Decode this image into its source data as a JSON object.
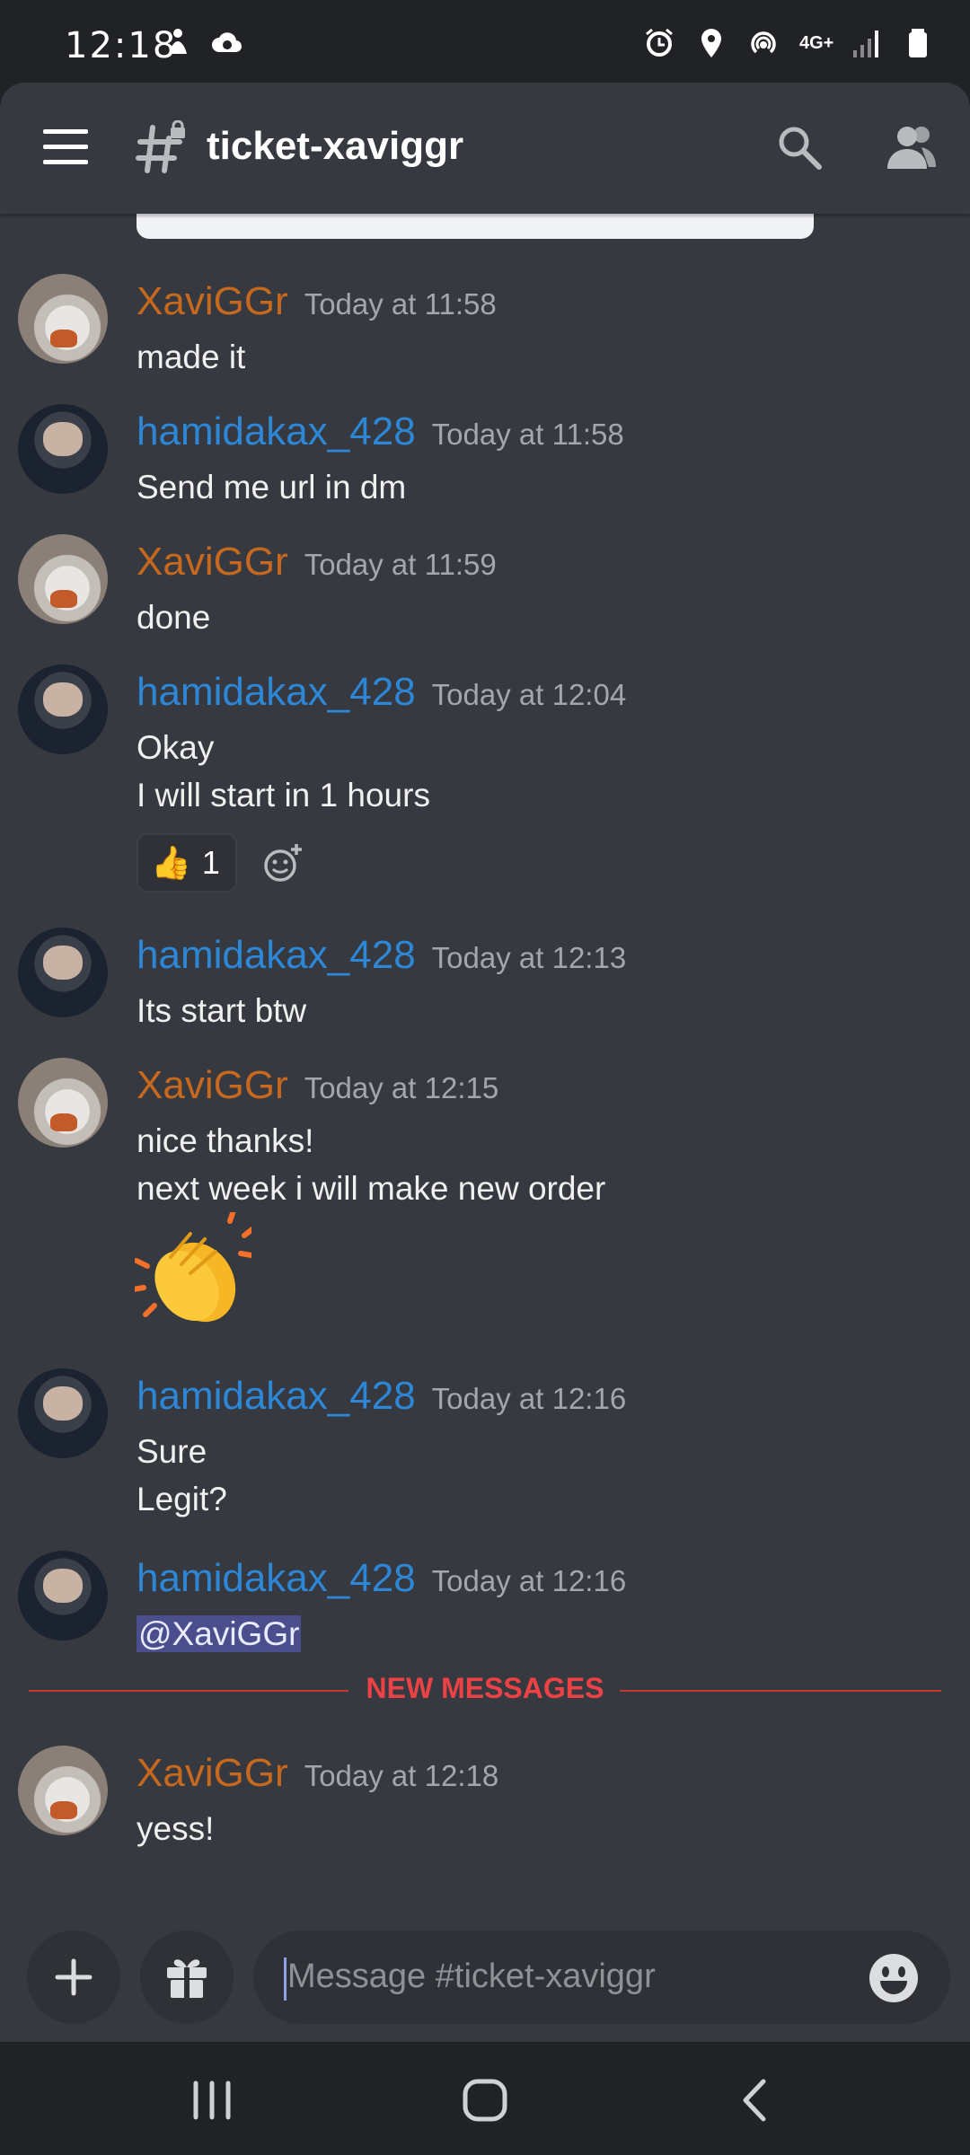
{
  "status_bar": {
    "time": "12:18",
    "network_label": "4G+"
  },
  "header": {
    "channel_name": "ticket-xaviggr"
  },
  "messages": [
    {
      "author": "XaviGGr",
      "timestamp": "Today at 11:58",
      "lines": [
        "made it"
      ]
    },
    {
      "author": "hamidakax_428",
      "timestamp": "Today at 11:58",
      "lines": [
        "Send me url in dm"
      ]
    },
    {
      "author": "XaviGGr",
      "timestamp": "Today at 11:59",
      "lines": [
        "done"
      ]
    },
    {
      "author": "hamidakax_428",
      "timestamp": "Today at 12:04",
      "lines": [
        "Okay",
        "I will start in 1 hours"
      ],
      "reaction": {
        "emoji": "👍",
        "count": "1"
      }
    },
    {
      "author": "hamidakax_428",
      "timestamp": "Today at 12:13",
      "lines": [
        "Its start btw"
      ]
    },
    {
      "author": "XaviGGr",
      "timestamp": "Today at 12:15",
      "lines": [
        "nice thanks!",
        "next week i will make new order"
      ],
      "emoji": "clapping-hands"
    },
    {
      "author": "hamidakax_428",
      "timestamp": "Today at 12:16",
      "lines": [
        "Sure",
        "Legit?"
      ]
    },
    {
      "author": "hamidakax_428",
      "timestamp": "Today at 12:16",
      "lines": [
        "@XaviGGr"
      ]
    },
    {
      "author": "XaviGGr",
      "timestamp": "Today at 12:18",
      "lines": [
        "yess!"
      ]
    }
  ],
  "new_messages_divider": "NEW MESSAGES",
  "composer": {
    "placeholder": "Message #ticket-xaviggr"
  },
  "colors": {
    "background": "#36393f",
    "xavi_name": "#c7681f",
    "hamid_name": "#2d87d6",
    "new_messages": "#ed4245"
  }
}
